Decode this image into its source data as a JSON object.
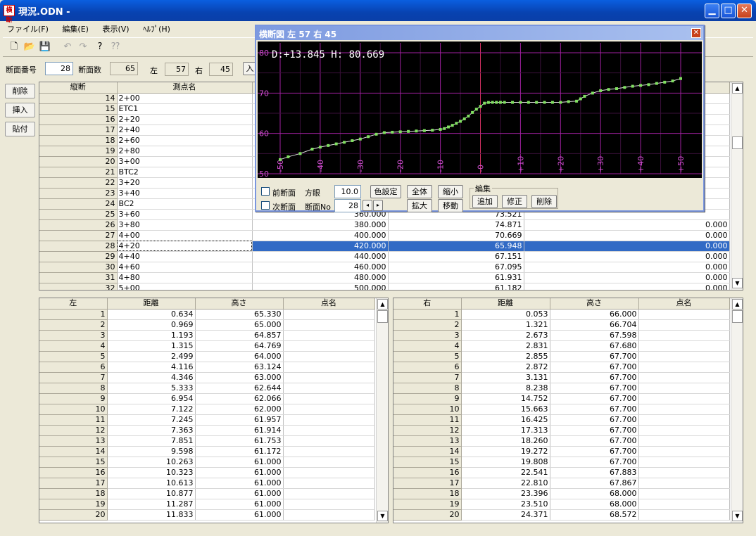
{
  "window": {
    "title": "現況.ODN -",
    "icon_text": "横断"
  },
  "menu": [
    "ファイル(F)",
    "編集(E)",
    "表示(V)",
    "ﾍﾙﾌﾟ(H)"
  ],
  "params": {
    "section_no_label": "断面番号",
    "section_no": "28",
    "section_count_label": "断面数",
    "section_count": "65",
    "left_label": "左",
    "left_value": "57",
    "right_label": "右",
    "right_value": "45",
    "input_btn": "入"
  },
  "side_buttons": [
    "削除",
    "挿入",
    "貼付"
  ],
  "upper_grid": {
    "headers": [
      "縦断",
      "測点名",
      "",
      "",
      ""
    ],
    "rows": [
      [
        "14",
        "2+00",
        "",
        "",
        ""
      ],
      [
        "15",
        "ETC1",
        "",
        "",
        ""
      ],
      [
        "16",
        "2+20",
        "",
        "",
        ""
      ],
      [
        "17",
        "2+40",
        "",
        "",
        ""
      ],
      [
        "18",
        "2+60",
        "",
        "",
        ""
      ],
      [
        "19",
        "2+80",
        "",
        "",
        ""
      ],
      [
        "20",
        "3+00",
        "",
        "",
        ""
      ],
      [
        "21",
        "BTC2",
        "",
        "",
        ""
      ],
      [
        "22",
        "3+20",
        "",
        "",
        ""
      ],
      [
        "23",
        "3+40",
        "",
        "",
        ""
      ],
      [
        "24",
        "BC2",
        "",
        "",
        ""
      ],
      [
        "25",
        "3+60",
        "360.000",
        "73.521",
        ""
      ],
      [
        "26",
        "3+80",
        "380.000",
        "74.871",
        "0.000"
      ],
      [
        "27",
        "4+00",
        "400.000",
        "70.669",
        "0.000"
      ],
      [
        "28",
        "4+20",
        "420.000",
        "65.948",
        "0.000"
      ],
      [
        "29",
        "4+40",
        "440.000",
        "67.151",
        "0.000"
      ],
      [
        "30",
        "4+60",
        "460.000",
        "67.095",
        "0.000"
      ],
      [
        "31",
        "4+80",
        "480.000",
        "61.931",
        "0.000"
      ],
      [
        "32",
        "5+00",
        "500.000",
        "61.182",
        "0.000"
      ]
    ],
    "selected_row": 14
  },
  "left_grid": {
    "headers": [
      "左",
      "距離",
      "高さ",
      "点名"
    ],
    "rows": [
      [
        "1",
        "0.634",
        "65.330"
      ],
      [
        "2",
        "0.969",
        "65.000"
      ],
      [
        "3",
        "1.193",
        "64.857"
      ],
      [
        "4",
        "1.315",
        "64.769"
      ],
      [
        "5",
        "2.499",
        "64.000"
      ],
      [
        "6",
        "4.116",
        "63.124"
      ],
      [
        "7",
        "4.346",
        "63.000"
      ],
      [
        "8",
        "5.333",
        "62.644"
      ],
      [
        "9",
        "6.954",
        "62.066"
      ],
      [
        "10",
        "7.122",
        "62.000"
      ],
      [
        "11",
        "7.245",
        "61.957"
      ],
      [
        "12",
        "7.363",
        "61.914"
      ],
      [
        "13",
        "7.851",
        "61.753"
      ],
      [
        "14",
        "9.598",
        "61.172"
      ],
      [
        "15",
        "10.263",
        "61.000"
      ],
      [
        "16",
        "10.323",
        "61.000"
      ],
      [
        "17",
        "10.613",
        "61.000"
      ],
      [
        "18",
        "10.877",
        "61.000"
      ],
      [
        "19",
        "11.287",
        "61.000"
      ],
      [
        "20",
        "11.833",
        "61.000"
      ]
    ]
  },
  "right_grid": {
    "headers": [
      "右",
      "距離",
      "高さ",
      "点名"
    ],
    "rows": [
      [
        "1",
        "0.053",
        "66.000"
      ],
      [
        "2",
        "1.321",
        "66.704"
      ],
      [
        "3",
        "2.673",
        "67.598"
      ],
      [
        "4",
        "2.831",
        "67.680"
      ],
      [
        "5",
        "2.855",
        "67.700"
      ],
      [
        "6",
        "2.872",
        "67.700"
      ],
      [
        "7",
        "3.131",
        "67.700"
      ],
      [
        "8",
        "8.238",
        "67.700"
      ],
      [
        "9",
        "14.752",
        "67.700"
      ],
      [
        "10",
        "15.663",
        "67.700"
      ],
      [
        "11",
        "16.425",
        "67.700"
      ],
      [
        "12",
        "17.313",
        "67.700"
      ],
      [
        "13",
        "18.260",
        "67.700"
      ],
      [
        "14",
        "19.272",
        "67.700"
      ],
      [
        "15",
        "19.808",
        "67.700"
      ],
      [
        "16",
        "22.541",
        "67.883"
      ],
      [
        "17",
        "22.810",
        "67.867"
      ],
      [
        "18",
        "23.396",
        "68.000"
      ],
      [
        "19",
        "23.510",
        "68.000"
      ],
      [
        "20",
        "24.371",
        "68.572"
      ]
    ]
  },
  "xsection": {
    "title": "横断図  左 57    右 45",
    "readout": "D:+13.845  H: 80.669",
    "prev_label": "前断面",
    "next_label": "次断面",
    "grid_label": "方眼",
    "grid_value": "10.0",
    "section_no_label": "断面No",
    "section_no_value": "28",
    "color_btn": "色設定",
    "all_btn": "全体",
    "shrink_btn": "縮小",
    "zoom_btn": "拡大",
    "move_btn": "移動",
    "edit_group": "編集",
    "add_btn": "追加",
    "modify_btn": "修正",
    "delete_btn": "削除"
  },
  "chart_data": {
    "type": "line",
    "x_ticks": [
      "-50",
      "-40",
      "-30",
      "-20",
      "-10",
      "-0",
      "+10",
      "+20",
      "+30",
      "+40",
      "+50"
    ],
    "y_ticks": [
      "50",
      "60",
      "70",
      "80"
    ],
    "xlim": [
      -50,
      50
    ],
    "ylim": [
      50,
      80
    ],
    "series": [
      {
        "x": [
          -50,
          -48,
          -45,
          -42,
          -40,
          -38,
          -36,
          -34,
          -32,
          -30,
          -28,
          -26,
          -24,
          -22,
          -20,
          -18,
          -16,
          -14,
          -12,
          -10,
          -9,
          -8,
          -7,
          -6,
          -5,
          -4,
          -3,
          -2,
          -1,
          0,
          1,
          2,
          3,
          4,
          5,
          6,
          8,
          10,
          12,
          14,
          16,
          18,
          20,
          22,
          24,
          25,
          26,
          28,
          30,
          32,
          34,
          36,
          38,
          40,
          42,
          44,
          46,
          48,
          50
        ],
        "y": [
          53.5,
          54.2,
          55.0,
          56.1,
          56.6,
          57.0,
          57.4,
          57.8,
          58.2,
          58.6,
          59.2,
          59.8,
          60.2,
          60.3,
          60.4,
          60.5,
          60.6,
          60.7,
          60.8,
          61.0,
          61.2,
          61.6,
          62.0,
          62.5,
          63.0,
          63.6,
          64.3,
          65.2,
          66.0,
          66.7,
          67.5,
          67.68,
          67.7,
          67.7,
          67.7,
          67.7,
          67.7,
          67.7,
          67.7,
          67.7,
          67.7,
          67.7,
          67.7,
          67.883,
          68.0,
          68.572,
          69.2,
          70.0,
          70.6,
          70.9,
          71.1,
          71.4,
          71.7,
          71.9,
          72.1,
          72.4,
          72.7,
          73.0,
          73.6
        ]
      }
    ]
  }
}
